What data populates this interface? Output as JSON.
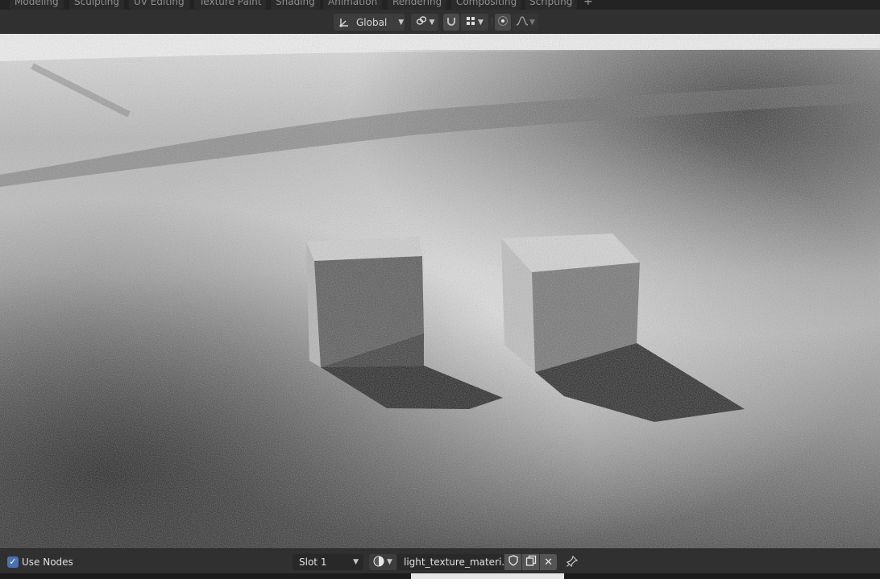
{
  "workspace_tabs": [
    "Modeling",
    "Sculpting",
    "UV Editing",
    "Texture Paint",
    "Shading",
    "Animation",
    "Rendering",
    "Compositing",
    "Scripting"
  ],
  "add_tab_symbol": "+",
  "viewport_header": {
    "transform_orientation": "Global",
    "icons": [
      "transform-gizmo-icon",
      "link-icon",
      "snap-icon",
      "snap-grid-icon",
      "proportional-edit-icon",
      "falloff-curve-icon"
    ]
  },
  "node_header": {
    "use_nodes_checked": true,
    "use_nodes_label": "Use Nodes",
    "slot_label": "Slot 1",
    "material_name": "light_texture_materi...",
    "icons": [
      "material-sphere-icon",
      "fake-user-shield-icon",
      "duplicate-icon",
      "close-icon",
      "pin-icon"
    ]
  },
  "colors": {
    "header_bg": "#303030",
    "accent_blue": "#4772b3"
  }
}
